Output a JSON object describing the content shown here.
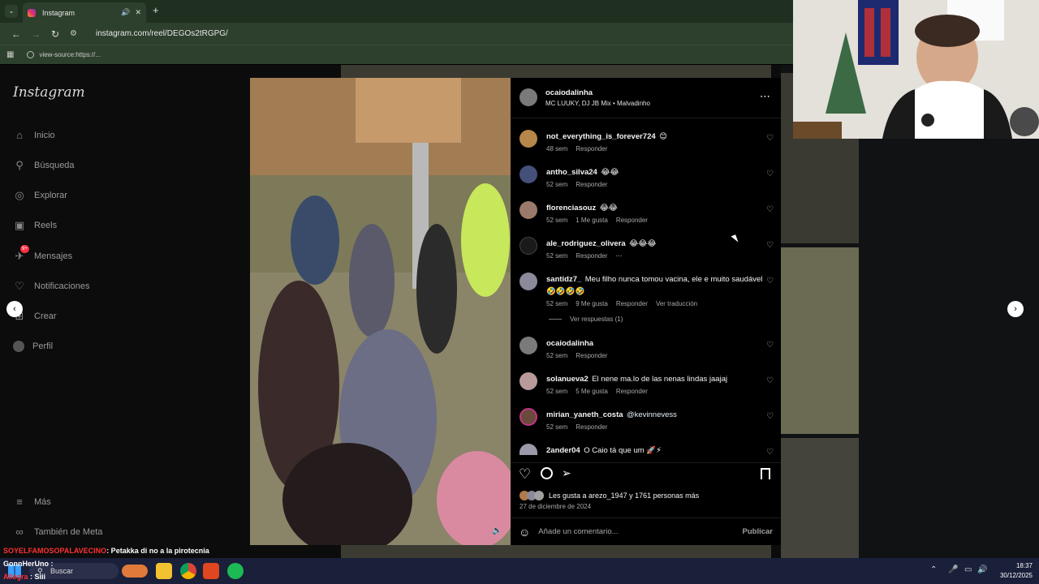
{
  "browser": {
    "tab_title": "Instagram",
    "new_tab_symbol": "+",
    "url": "instagram.com/reel/DEGOs2tRGPG/",
    "bookmark": "view-source:https://..."
  },
  "sidebar": {
    "logo": "Instagram",
    "items": [
      {
        "label": "Inicio",
        "icon": "home-icon"
      },
      {
        "label": "Búsqueda",
        "icon": "search-icon"
      },
      {
        "label": "Explorar",
        "icon": "compass-icon"
      },
      {
        "label": "Reels",
        "icon": "reels-icon"
      },
      {
        "label": "Mensajes",
        "icon": "messenger-icon",
        "badge": "9+"
      },
      {
        "label": "Notificaciones",
        "icon": "heart-icon"
      },
      {
        "label": "Crear",
        "icon": "plus-icon"
      },
      {
        "label": "Perfil",
        "icon": "profile-icon"
      }
    ],
    "more": "Más",
    "meta": "También de Meta"
  },
  "post": {
    "author": "ocaiodalinha",
    "audio": "MC LUUKY, DJ JB Mix • Malvadinho",
    "likes_text": "Les gusta a arezo_1947 y 1761 personas más",
    "date": "27 de diciembre de 2024",
    "add_comment_placeholder": "Añade un comentario...",
    "publish": "Publicar"
  },
  "comments": [
    {
      "user": "not_everything_is_forever724",
      "text": "😊",
      "age": "48 sem",
      "likes": "",
      "reply": "Responder"
    },
    {
      "user": "antho_silva24",
      "text": "😂😂",
      "age": "52 sem",
      "likes": "",
      "reply": "Responder"
    },
    {
      "user": "florenciasouz",
      "text": "😂😂",
      "age": "52 sem",
      "likes": "1 Me gusta",
      "reply": "Responder"
    },
    {
      "user": "ale_rodriguez_olivera",
      "text": "😂😂😂",
      "age": "52 sem",
      "likes": "",
      "reply": "Responder",
      "more": "···"
    },
    {
      "user": "santidz7_",
      "text": "Meu filho nunca tomou vacina, ele e muito saudável 🤣🤣🤣🤣",
      "age": "52 sem",
      "likes": "9 Me gusta",
      "reply": "Responder",
      "translate": "Ver traducción"
    },
    {
      "user": "ocaiodalinha",
      "text": "",
      "age": "52 sem",
      "likes": "",
      "reply": "Responder"
    },
    {
      "user": "solanueva2",
      "text": "El nene ma.lo de las nenas lindas jaajaj",
      "age": "52 sem",
      "likes": "5 Me gusta",
      "reply": "Responder"
    },
    {
      "user": "mirian_yaneth_costa",
      "text": "@kevinnevess",
      "age": "52 sem",
      "likes": "",
      "reply": "Responder"
    },
    {
      "user": "2ander04",
      "text": "O Caio tá que um 🚀⚡",
      "age": "",
      "likes": "",
      "reply": ""
    }
  ],
  "view_replies": "Ver respuestas (1)",
  "chat": [
    {
      "user": "SOYELFAMOSOPALAVECINO",
      "message": ": Petakka di no a la pirotecnia",
      "color": "#ff3030"
    },
    {
      "user": "GonnHerUno",
      "message": ":",
      "color": "#ffffff"
    },
    {
      "user": "Allegra",
      "message": ": Siii",
      "color": "#ff3030"
    }
  ],
  "taskbar": {
    "search": "Buscar",
    "time": "18:37",
    "date": "30/12/2025"
  },
  "colors": {
    "page_bg": "#0c0c0c",
    "panel_bg": "#000000",
    "chrome_green": "#203020",
    "link_blue": "#e0f1ff",
    "taskbar": "#1a1f3a"
  }
}
